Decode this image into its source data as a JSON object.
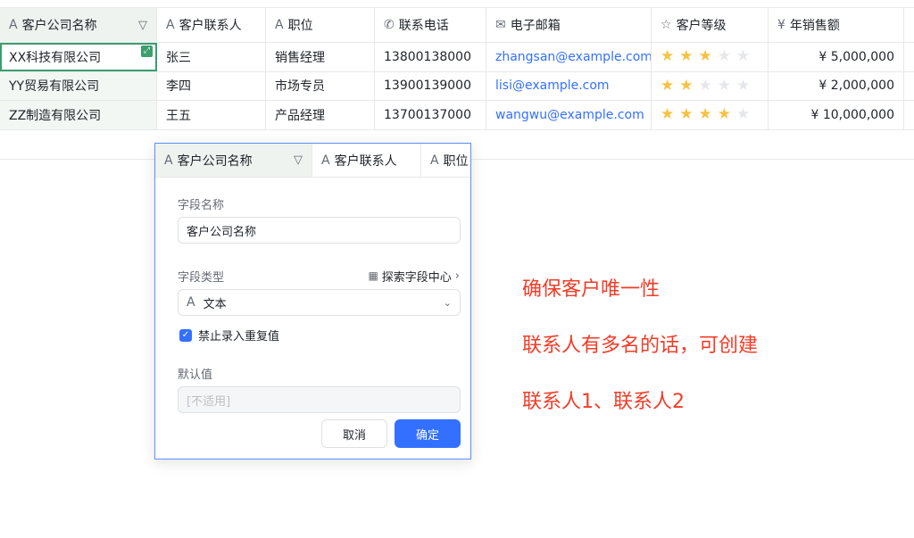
{
  "table": {
    "headers": [
      {
        "icon": "A",
        "label": "客户公司名称"
      },
      {
        "icon": "A",
        "label": "客户联系人"
      },
      {
        "icon": "A",
        "label": "职位"
      },
      {
        "icon": "✆",
        "label": "联系电话"
      },
      {
        "icon": "✉",
        "label": "电子邮箱"
      },
      {
        "icon": "☆",
        "label": "客户等级"
      },
      {
        "icon": "¥",
        "label": "年销售额"
      }
    ],
    "rows": [
      {
        "company": "XX科技有限公司",
        "contact": "张三",
        "title": "销售经理",
        "phone": "13800138000",
        "email": "zhangsan@example.com",
        "rating": 3,
        "sales": "¥ 5,000,000"
      },
      {
        "company": "YY贸易有限公司",
        "contact": "李四",
        "title": "市场专员",
        "phone": "13900139000",
        "email": "lisi@example.com",
        "rating": 2,
        "sales": "¥ 2,000,000"
      },
      {
        "company": "ZZ制造有限公司",
        "contact": "王五",
        "title": "产品经理",
        "phone": "13700137000",
        "email": "wangwu@example.com",
        "rating": 4,
        "sales": "¥ 10,000,000"
      }
    ],
    "rating_max": 5
  },
  "popup": {
    "headers": [
      {
        "icon": "A",
        "label": "客户公司名称"
      },
      {
        "icon": "A",
        "label": "客户联系人"
      },
      {
        "icon": "A",
        "label": "职位"
      }
    ],
    "field_name_label": "字段名称",
    "field_name_value": "客户公司名称",
    "field_type_label": "字段类型",
    "explore_label": "探索字段中心",
    "field_type_value": "文本",
    "field_type_icon": "A",
    "no_duplicate_label": "禁止录入重复值",
    "no_duplicate_checked": true,
    "default_label": "默认值",
    "default_placeholder": "[不适用]",
    "cancel_label": "取消",
    "ok_label": "确定"
  },
  "notes": [
    "确保客户唯一性",
    "联系人有多名的话，可创建",
    "联系人1、联系人2"
  ],
  "colors": {
    "accent": "#3370ff",
    "star": "#f5c243",
    "note": "#f23c27",
    "selection": "#3a9e6d"
  }
}
